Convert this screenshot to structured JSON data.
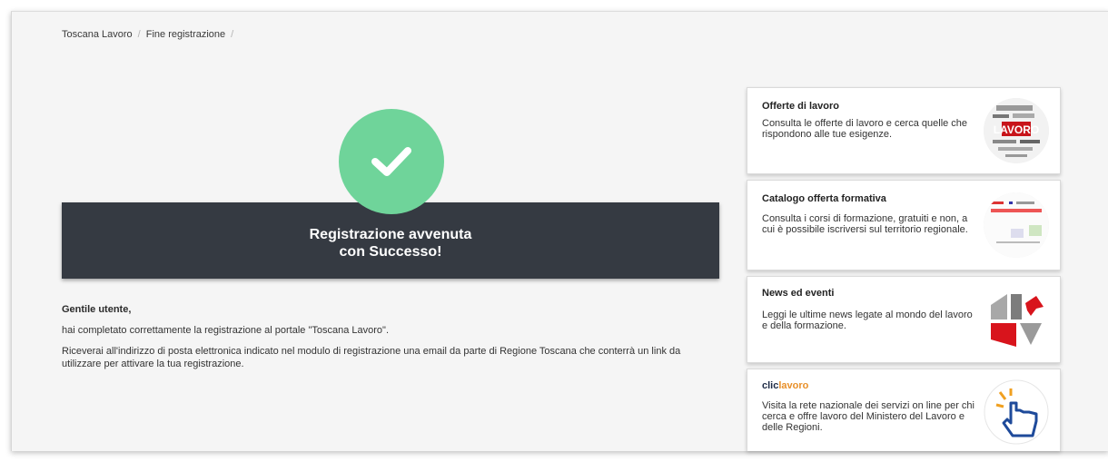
{
  "breadcrumb": {
    "items": [
      "Toscana Lavoro",
      "Fine registrazione"
    ],
    "separator": "/"
  },
  "success": {
    "icon": "checkmark-icon",
    "circle_color": "#6fd49a",
    "banner_line1": "Registrazione avvenuta",
    "banner_line2": "con Successo!",
    "banner_color": "#353a42"
  },
  "message": {
    "greeting": "Gentile utente,",
    "paragraph1": "hai completato correttamente la registrazione al portale \"Toscana Lavoro\".",
    "paragraph2": "Riceverai all'indirizzo di posta elettronica indicato nel modulo di registrazione una email da parte di Regione Toscana che conterrà un link da utilizzare per attivare la tua registrazione."
  },
  "sidebar": {
    "cards": [
      {
        "title": "Offerte di lavoro",
        "desc": "Consulta le offerte di lavoro e cerca quelle che rispondono alle tue esigenze.",
        "thumb": "lavoro-wordcloud-icon"
      },
      {
        "title": "Catalogo offerta formativa",
        "desc": "Consulta i corsi di formazione, gratuiti e non, a cui è possibile iscriversi sul territorio regionale.",
        "thumb": "catalogo-screenshot-icon"
      },
      {
        "title": "News ed eventi",
        "desc": "Leggi le ultime news legate al mondo del lavoro e della formazione.",
        "thumb": "regione-toscana-logo-icon"
      },
      {
        "title_part1": "clic",
        "title_part2": "lavoro",
        "desc": "Visita la rete nazionale dei servizi on line per chi cerca e offre lavoro del Ministero del Lavoro e delle Regioni.",
        "thumb": "pointing-hand-icon"
      }
    ],
    "accent_color": "#e8902a"
  }
}
